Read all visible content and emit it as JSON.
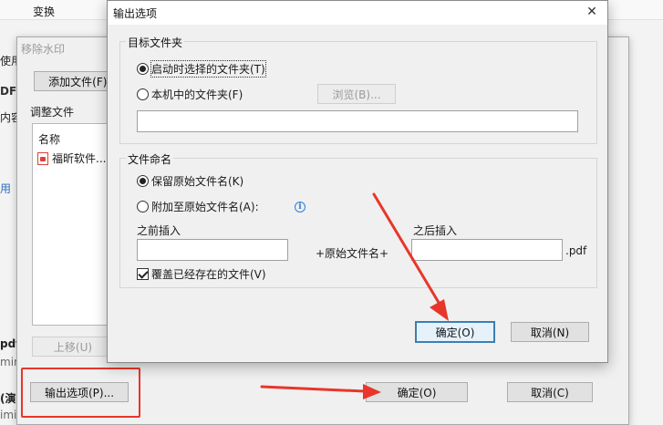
{
  "app_bar": {
    "menu_transform": "变换"
  },
  "left_fragments": [
    "使用",
    "DF",
    "内容",
    "用",
    "pdf",
    "min",
    "(演",
    "imi"
  ],
  "remove_watermark_dialog": {
    "title": "移除水印",
    "add_files_button": "添加文件(F)...",
    "adjust_files_label": "调整文件",
    "list_header_name": "名称",
    "file_item": "福昕软件...",
    "move_up_button": "上移(U)",
    "output_options_button": "输出选项(P)...",
    "ok_button": "确定(O)",
    "cancel_button": "取消(C)"
  },
  "output_options_dialog": {
    "title": "输出选项",
    "close_glyph": "✕",
    "target_folder_group": "目标文件夹",
    "option_select_on_start": "启动时选择的文件夹(T)",
    "option_local_folder": "本机中的文件夹(F)",
    "browse_button": "浏览(B)...",
    "folder_path_value": "",
    "file_naming_group": "文件命名",
    "option_keep_original": "保留原始文件名(K)",
    "option_append": "附加至原始文件名(A):",
    "info_glyph": "i",
    "prefix_label": "之前插入",
    "prefix_value": "",
    "original_name_label": "+原始文件名+",
    "suffix_label": "之后插入",
    "suffix_value": "",
    "extension_label": ".pdf",
    "overwrite_checkbox": "覆盖已经存在的文件(V)",
    "ok_button": "确定(O)",
    "cancel_button": "取消(N)"
  },
  "selection_state": {
    "target_folder_selected": "option_select_on_start",
    "naming_selected": "option_keep_original",
    "overwrite_checked": true
  },
  "colors": {
    "annotation_red": "#e8362b",
    "primary_button_border": "#3c7fb1",
    "info_blue": "#2a7fd4"
  }
}
